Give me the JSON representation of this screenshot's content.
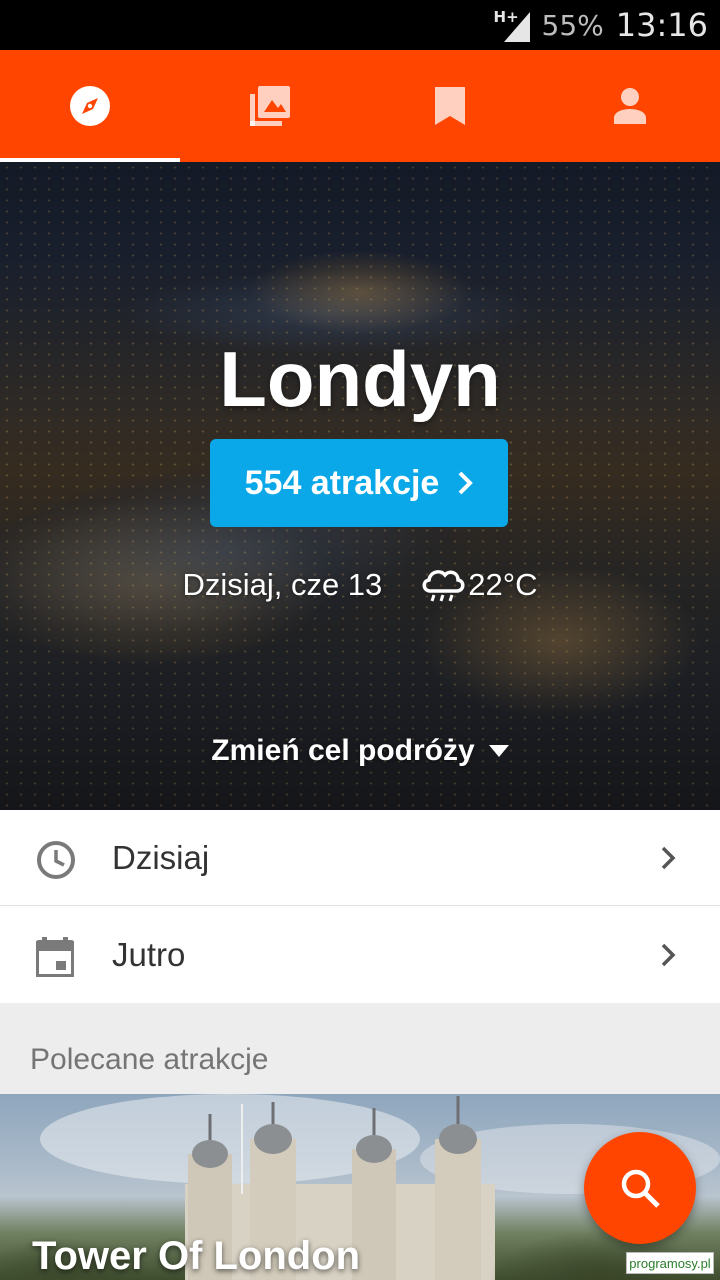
{
  "status_bar": {
    "network": "H+",
    "battery": "55%",
    "time": "13:16"
  },
  "tabs": [
    {
      "icon": "compass-icon",
      "active": true
    },
    {
      "icon": "photo-library-icon",
      "active": false
    },
    {
      "icon": "bookmark-icon",
      "active": false
    },
    {
      "icon": "person-icon",
      "active": false
    }
  ],
  "hero": {
    "city": "Londyn",
    "attractions_label": "554 atrakcje",
    "date": "Dzisiaj, cze 13",
    "weather_icon": "cloud-rain-icon",
    "temperature": "22°C",
    "change_destination": "Zmień cel podróży"
  },
  "list": {
    "today": "Dzisiaj",
    "tomorrow": "Jutro"
  },
  "section": {
    "title": "Polecane atrakcje"
  },
  "featured": {
    "name": "Tower Of London"
  },
  "watermark": "programosy.pl",
  "colors": {
    "accent": "#ff4500",
    "button": "#0aa8e8"
  }
}
